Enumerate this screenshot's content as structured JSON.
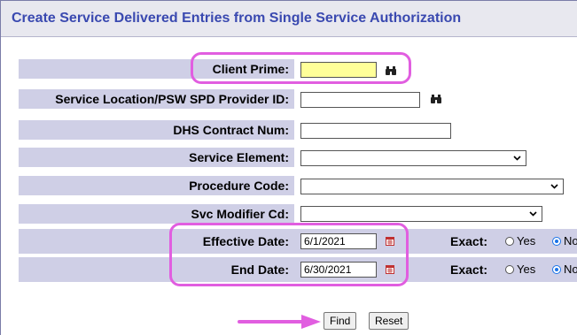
{
  "page": {
    "title": "Create Service Delivered Entries from Single Service Authorization"
  },
  "form": {
    "client_prime": {
      "label": "Client Prime:",
      "value": ""
    },
    "service_location": {
      "label": "Service Location/PSW SPD Provider ID:",
      "value": ""
    },
    "dhs_contract": {
      "label": "DHS Contract Num:",
      "value": ""
    },
    "service_element": {
      "label": "Service Element:",
      "value": ""
    },
    "procedure_code": {
      "label": "Procedure Code:",
      "value": ""
    },
    "svc_modifier": {
      "label": "Svc Modifier Cd:",
      "value": ""
    },
    "effective_date": {
      "label": "Effective Date:",
      "value": "6/1/2021",
      "exact_label": "Exact:",
      "opt_yes": "Yes",
      "opt_no": "No",
      "selected": "No"
    },
    "end_date": {
      "label": "End Date:",
      "value": "6/30/2021",
      "exact_label": "Exact:",
      "opt_yes": "Yes",
      "opt_no": "No",
      "selected": "No"
    }
  },
  "buttons": {
    "find": "Find",
    "reset": "Reset"
  },
  "colors": {
    "title": "#3a49b0",
    "label_bg": "#cfcfe6",
    "client_prime_bg": "#ffff99",
    "annotation": "#e15ee0",
    "radio_checked": "#1a73e8"
  },
  "icons": {
    "lookup": "binoculars-icon",
    "date": "calendar-icon",
    "dropdown": "chevron-down-icon",
    "annotation": "arrow-right-icon"
  }
}
